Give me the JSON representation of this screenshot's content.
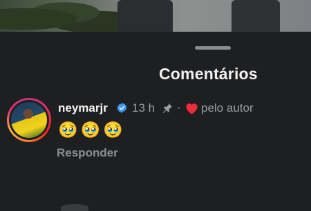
{
  "header": {
    "title": "Comentários"
  },
  "comment": {
    "username": "neymarjr",
    "verified_icon": "verified-badge-icon",
    "time": "13 h",
    "pin_icon": "pin-icon",
    "separator": "·",
    "heart_icon": "heart-icon",
    "liked_by": "pelo autor",
    "text": "🥹🥹🥹",
    "reply_label": "Responder"
  },
  "colors": {
    "background": "#1e1f20",
    "title": "#f2f2f2",
    "secondary_text": "#9c9d9f",
    "verified_blue": "#3897f0",
    "heart_red": "#ed2d3c"
  }
}
